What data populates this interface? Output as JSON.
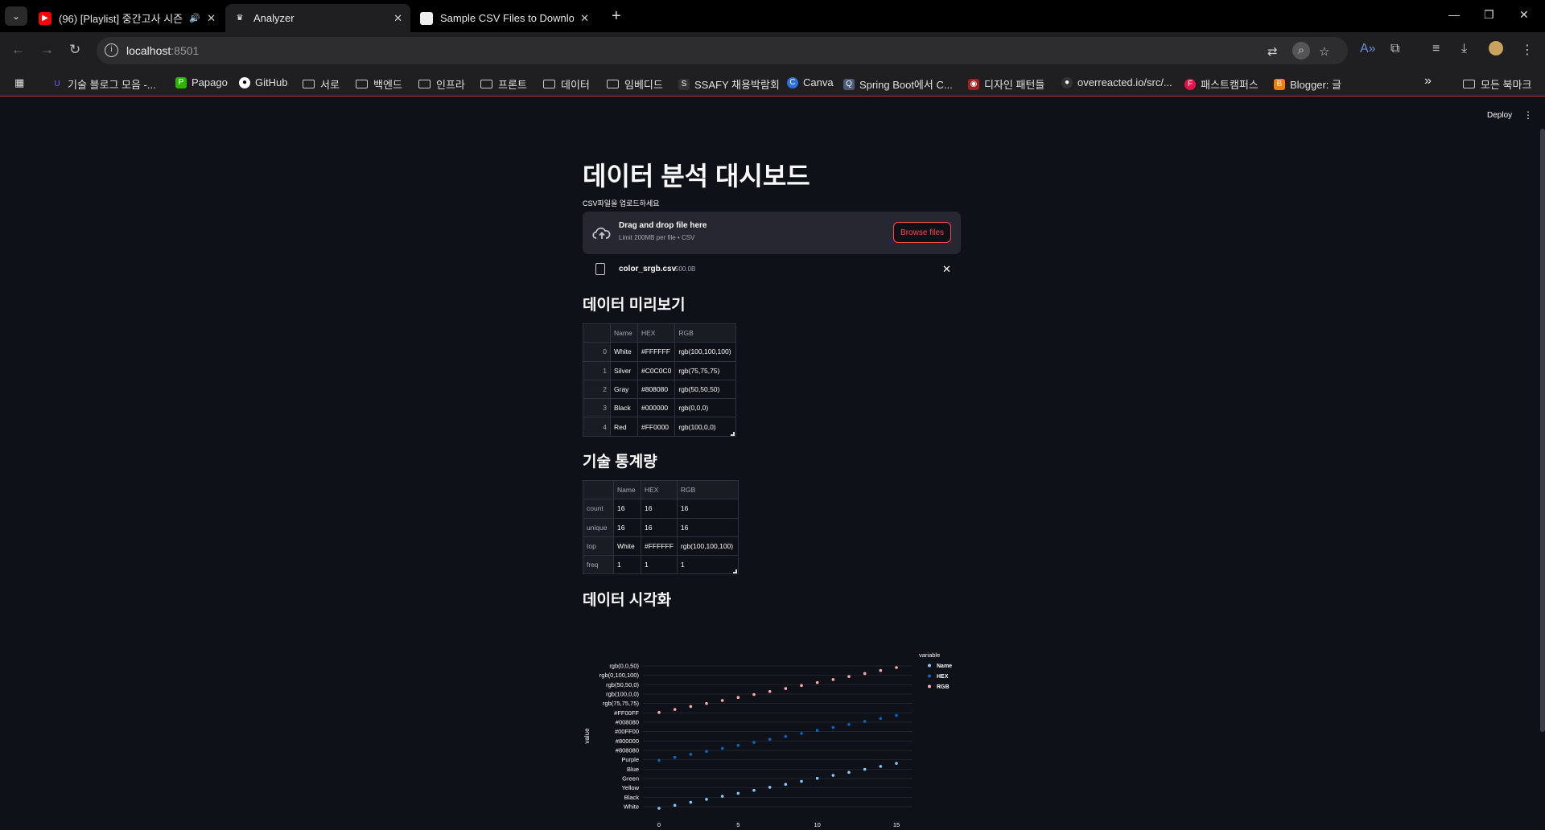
{
  "browser": {
    "tabs": [
      {
        "title": "(96) [Playlist] 중간고사 시즌",
        "favicon": "youtube-icon",
        "audio": true
      },
      {
        "title": "Analyzer",
        "favicon": "streamlit-icon",
        "active": true
      },
      {
        "title": "Sample CSV Files to Download",
        "favicon": "page-icon"
      }
    ],
    "url_host": "localhost",
    "url_port": ":8501",
    "bookmarks": [
      {
        "label": "기술 블로그 모음 -...",
        "icon": "bookmark-icon"
      },
      {
        "label": "Papago",
        "icon": "papago-icon"
      },
      {
        "label": "GitHub",
        "icon": "github-icon"
      },
      {
        "label": "서로",
        "icon": "folder-icon"
      },
      {
        "label": "백엔드",
        "icon": "folder-icon"
      },
      {
        "label": "인프라",
        "icon": "folder-icon"
      },
      {
        "label": "프론트",
        "icon": "folder-icon"
      },
      {
        "label": "데이터",
        "icon": "folder-icon"
      },
      {
        "label": "임베디드",
        "icon": "folder-icon"
      },
      {
        "label": "SSAFY 채용박람회",
        "icon": "ssafy-icon"
      },
      {
        "label": "Canva",
        "icon": "canva-icon"
      },
      {
        "label": "Spring Boot에서 C...",
        "icon": "bookmark-icon"
      },
      {
        "label": "디자인 패턴들",
        "icon": "bookmark-icon"
      },
      {
        "label": "overreacted.io/src/...",
        "icon": "github-icon"
      },
      {
        "label": "패스트캠퍼스",
        "icon": "fastcampus-icon"
      },
      {
        "label": "Blogger: 글",
        "icon": "blogger-icon"
      }
    ],
    "more_bookmarks": "»",
    "all_bookmarks": "모든 북마크"
  },
  "app": {
    "deploy": "Deploy",
    "title": "데이터 분석 대시보드",
    "upload_label": "CSV파일을 업로드하세요",
    "dropzone_title": "Drag and drop file here",
    "dropzone_limit": "Limit 200MB per file • CSV",
    "browse_button": "Browse files",
    "file_name": "color_srgb.csv",
    "file_size": "500.0B",
    "preview_heading": "데이터 미리보기",
    "preview_table": {
      "columns": [
        "",
        "Name",
        "HEX",
        "RGB"
      ],
      "rows": [
        [
          "0",
          "White",
          "#FFFFFF",
          "rgb(100,100,100)"
        ],
        [
          "1",
          "Silver",
          "#C0C0C0",
          "rgb(75,75,75)"
        ],
        [
          "2",
          "Gray",
          "#808080",
          "rgb(50,50,50)"
        ],
        [
          "3",
          "Black",
          "#000000",
          "rgb(0,0,0)"
        ],
        [
          "4",
          "Red",
          "#FF0000",
          "rgb(100,0,0)"
        ]
      ]
    },
    "stats_heading": "기술 통계량",
    "stats_table": {
      "columns": [
        "",
        "Name",
        "HEX",
        "RGB"
      ],
      "rows": [
        [
          "count",
          "16",
          "16",
          "16"
        ],
        [
          "unique",
          "16",
          "16",
          "16"
        ],
        [
          "top",
          "White",
          "#FFFFFF",
          "rgb(100,100,100)"
        ],
        [
          "freq",
          "1",
          "1",
          "1"
        ]
      ]
    },
    "viz_heading": "데이터 시각화"
  },
  "chart_data": {
    "type": "scatter",
    "xlabel": "",
    "ylabel": "value",
    "xticks": [
      0,
      5,
      10,
      15
    ],
    "xlim": [
      0,
      15
    ],
    "y_tick_labels": [
      "White",
      "Black",
      "Yellow",
      "Green",
      "Blue",
      "Purple",
      "#808080",
      "#800000",
      "#00FF00",
      "#008080",
      "#FF00FF",
      "rgb(75,75,75)",
      "rgb(100,0,0)",
      "rgb(50,50,0)",
      "rgb(0,100,100)",
      "rgb(0,0,50)"
    ],
    "legend_title": "variable",
    "legend_position": "right",
    "x": [
      0,
      1,
      2,
      3,
      4,
      5,
      6,
      7,
      8,
      9,
      10,
      11,
      12,
      13,
      14,
      15
    ],
    "series": [
      {
        "name": "Name",
        "color": "#83c9ff",
        "y_rank": [
          0,
          1,
          2,
          3,
          4,
          5,
          6,
          7,
          8,
          9,
          10,
          11,
          12,
          13,
          14,
          15
        ]
      },
      {
        "name": "HEX",
        "color": "#0068c9",
        "y_rank": [
          16,
          17,
          18,
          19,
          20,
          21,
          22,
          23,
          24,
          25,
          26,
          27,
          28,
          29,
          30,
          31
        ]
      },
      {
        "name": "RGB",
        "color": "#ffabab",
        "y_rank": [
          32,
          33,
          34,
          35,
          36,
          37,
          38,
          39,
          40,
          41,
          42,
          43,
          44,
          45,
          46,
          47
        ]
      }
    ],
    "grid": true
  }
}
